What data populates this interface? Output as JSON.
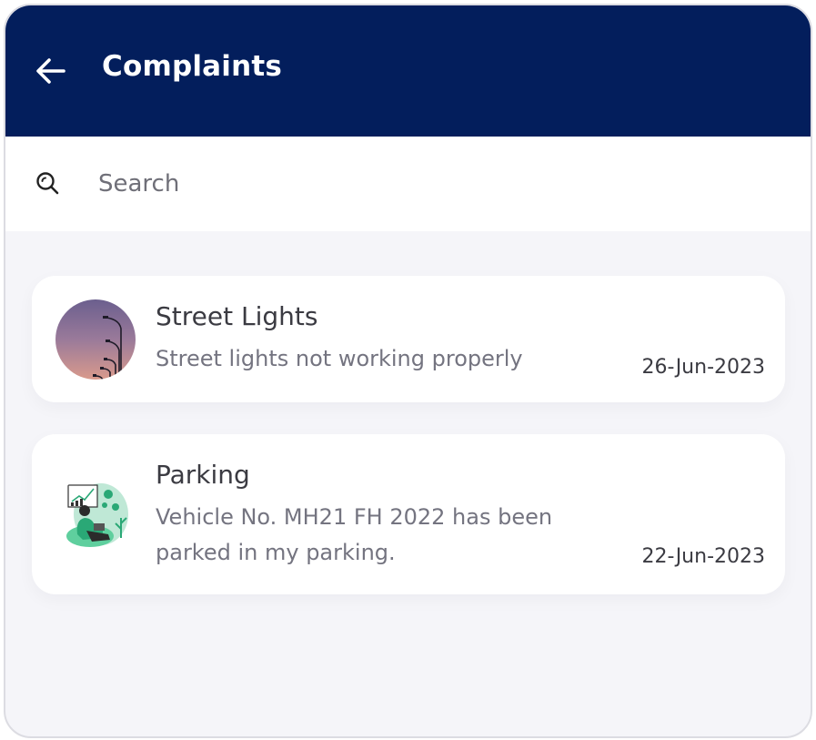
{
  "header": {
    "title": "Complaints",
    "background_color": "#031e5c",
    "back_icon": "arrow-left-icon"
  },
  "search": {
    "placeholder": "Search",
    "value": "",
    "icon": "search-icon"
  },
  "complaints": [
    {
      "title": "Street Lights",
      "description": "Street lights not working properly",
      "date": "26-Jun-2023",
      "thumbnail": "street-lights-image"
    },
    {
      "title": "Parking",
      "description": "Vehicle No. MH21 FH 2022 has been parked in my parking.",
      "date": "22-Jun-2023",
      "thumbnail": "parking-illustration"
    }
  ]
}
